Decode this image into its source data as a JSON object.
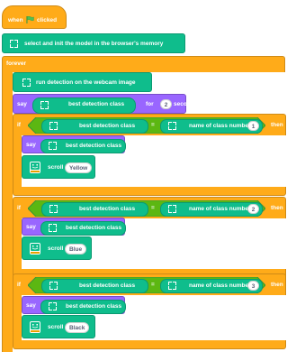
{
  "hat": {
    "when": "when",
    "clicked": "clicked"
  },
  "init_block": {
    "label": "select and init the model in the browser's memory"
  },
  "forever": {
    "label": "forever"
  },
  "run_detection": {
    "label": "run detection on the webcam image"
  },
  "say_for": {
    "say": "say",
    "reporter": "best detection class",
    "for": "for",
    "seconds_value": "2",
    "seconds": "seconds"
  },
  "if_blocks": [
    {
      "if": "if",
      "left": "best detection class",
      "eq": "=",
      "right": "name of class number",
      "class_num": "1",
      "then": "then",
      "say": "say",
      "say_reporter": "best detection class",
      "scroll": "scroll",
      "scroll_value": "Yellow"
    },
    {
      "if": "if",
      "left": "best detection class",
      "eq": "=",
      "right": "name of class number",
      "class_num": "2",
      "then": "then",
      "say": "say",
      "say_reporter": "best detection class",
      "scroll": "scroll",
      "scroll_value": "Blue"
    },
    {
      "if": "if",
      "left": "best detection class",
      "eq": "=",
      "right": "name of class number",
      "class_num": "3",
      "then": "then",
      "say": "say",
      "say_reporter": "best detection class",
      "scroll": "scroll",
      "scroll_value": "Black"
    }
  ],
  "colors": {
    "events": "#ffab19",
    "extension": "#0fbd8c",
    "looks": "#9966ff",
    "control": "#ffab19"
  },
  "icons": {
    "flag": "green-flag-icon",
    "model": "model-frame-icon",
    "microbit": "microbit-icon"
  }
}
